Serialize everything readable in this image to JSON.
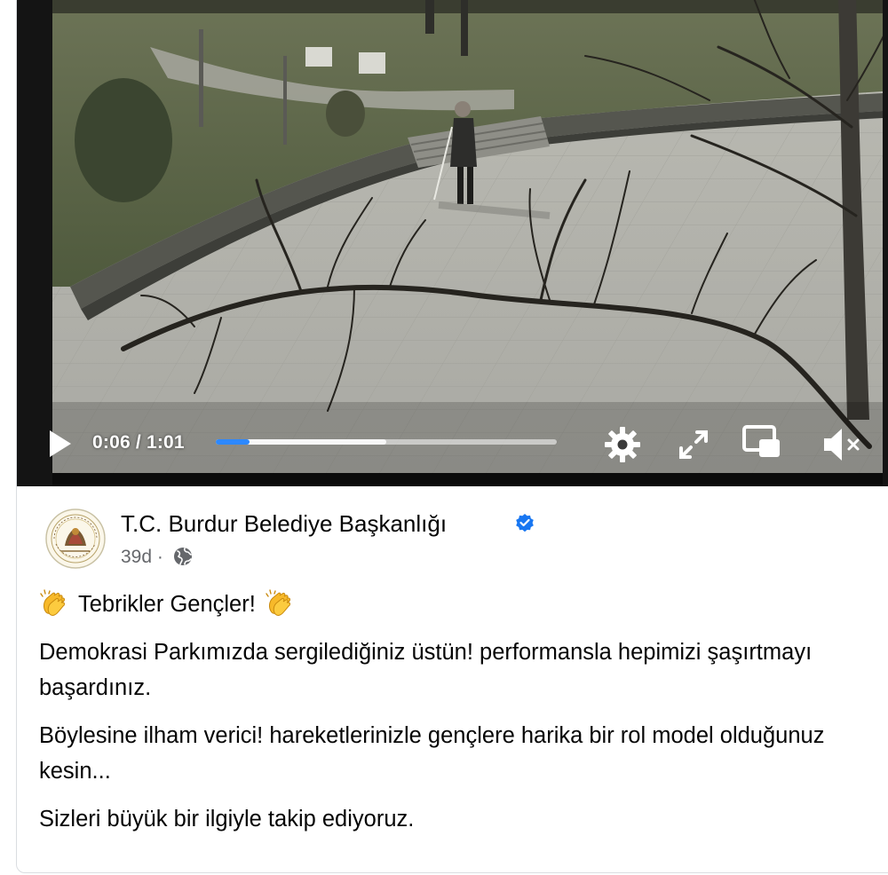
{
  "video": {
    "current_time": "0:06",
    "duration": "1:01",
    "separator": "/",
    "progress_fraction": 0.098,
    "buffered_fraction": 0.5,
    "controls": [
      "play-icon",
      "settings-gear-icon",
      "fullscreen-icon",
      "picture-in-picture-icon",
      "volume-muted-icon"
    ]
  },
  "post": {
    "page_name": "T.C. Burdur Belediye Başkanlığı",
    "verified": true,
    "timestamp": "39d",
    "meta_dot": "·",
    "audience_icon": "globe-icon",
    "headline": "Tebrikler Gençler!",
    "headline_emoji": "clapping-hands-icon",
    "paragraphs": [
      "Demokrasi Parkımızda sergilediğiniz üstün! performansla hepimizi şaşırtmayı başardınız.",
      "Böylesine ilham verici! hareketlerinizle gençlere harika bir rol model olduğunuz kesin...",
      "Sizleri büyük bir ilgiyle takip ediyoruz."
    ]
  },
  "colors": {
    "accent_blue": "#1877f2",
    "progress_blue": "#2d88ff",
    "text_primary": "#050505",
    "text_secondary": "#65676b"
  }
}
